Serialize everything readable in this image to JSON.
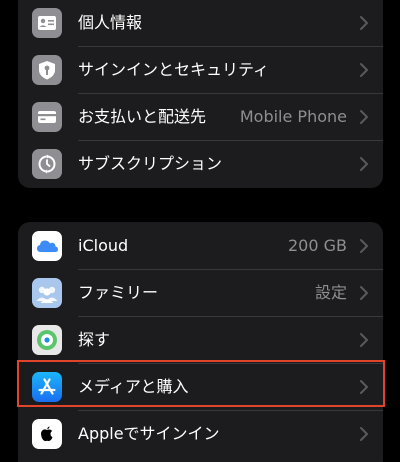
{
  "account_group": {
    "items": [
      {
        "label": "個人情報",
        "value": "",
        "icon": "person-card-icon"
      },
      {
        "label": "サインインとセキュリティ",
        "value": "",
        "icon": "key-shield-icon"
      },
      {
        "label": "お支払いと配送先",
        "value": "Mobile Phone",
        "icon": "credit-card-icon"
      },
      {
        "label": "サブスクリプション",
        "value": "",
        "icon": "subscription-icon"
      }
    ]
  },
  "services_group": {
    "items": [
      {
        "label": "iCloud",
        "value": "200 GB",
        "icon": "icloud-icon"
      },
      {
        "label": "ファミリー",
        "value": "設定",
        "icon": "family-icon"
      },
      {
        "label": "探す",
        "value": "",
        "icon": "find-my-icon"
      },
      {
        "label": "メディアと購入",
        "value": "",
        "icon": "app-store-icon"
      },
      {
        "label": "Appleでサインイン",
        "value": "",
        "icon": "apple-logo-icon"
      }
    ]
  },
  "highlighted_item": "メディアと購入",
  "colors": {
    "background": "#000000",
    "cell": "#1c1c1e",
    "secondary_text": "#8e8e93",
    "highlight": "#e0452c",
    "gray_icon": "#8e8e93",
    "icloud_blue": "#3d8cf5",
    "appstore_blue": "#1a84f2"
  }
}
